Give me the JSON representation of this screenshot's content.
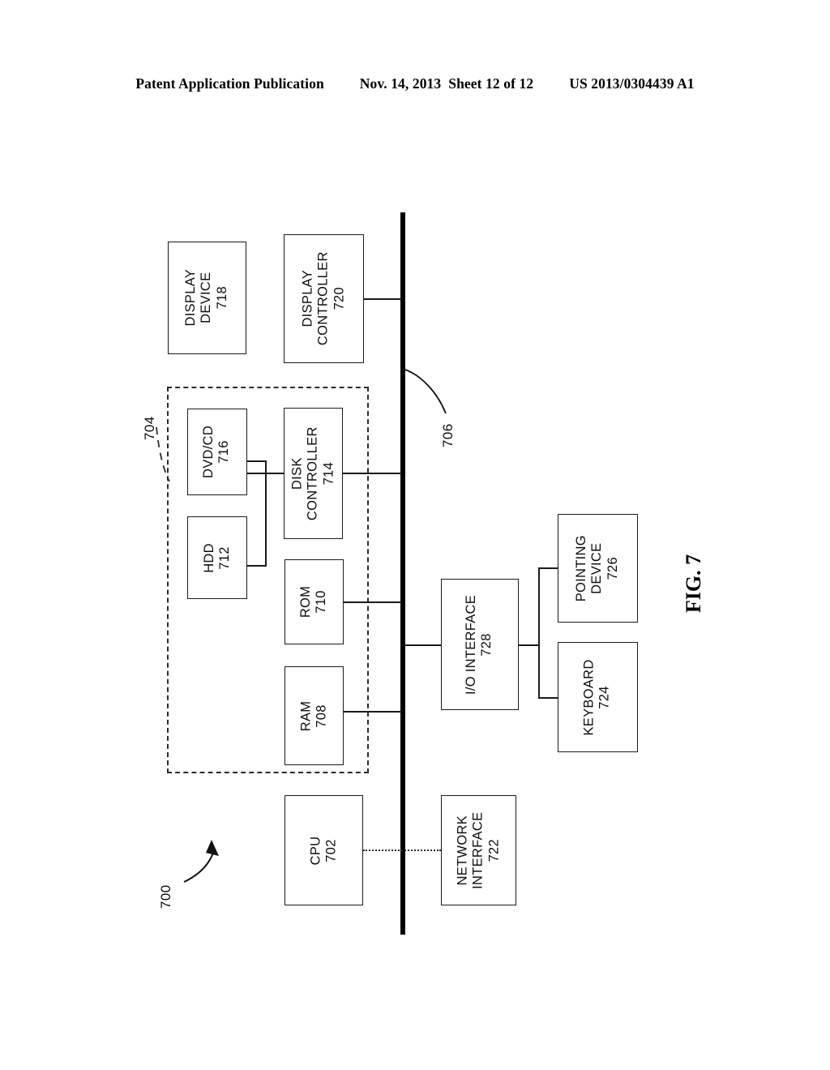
{
  "header": {
    "publication": "Patent Application Publication",
    "date": "Nov. 14, 2013",
    "sheet": "Sheet 12 of 12",
    "patent_number": "US 2013/0304439 A1"
  },
  "figure": {
    "caption": "FIG. 7",
    "system_ref": "700",
    "memory_group_ref": "704",
    "bus_ref": "706"
  },
  "blocks": {
    "display_device": {
      "line1": "DISPLAY",
      "line2": "DEVICE",
      "ref": "718"
    },
    "display_controller": {
      "line1": "DISPLAY",
      "line2": "CONTROLLER",
      "ref": "720"
    },
    "dvd_cd": {
      "line1": "DVD/CD",
      "ref": "716"
    },
    "hdd": {
      "line1": "HDD",
      "ref": "712"
    },
    "disk_controller": {
      "line1": "DISK",
      "line2": "CONTROLLER",
      "ref": "714"
    },
    "rom": {
      "line1": "ROM",
      "ref": "710"
    },
    "ram": {
      "line1": "RAM",
      "ref": "708"
    },
    "io_interface": {
      "line1": "I/O INTERFACE",
      "ref": "728"
    },
    "pointing_device": {
      "line1": "POINTING",
      "line2": "DEVICE",
      "ref": "726"
    },
    "keyboard": {
      "line1": "KEYBOARD",
      "ref": "724"
    },
    "cpu": {
      "line1": "CPU",
      "ref": "702"
    },
    "network_interface": {
      "line1": "NETWORK",
      "line2": "INTERFACE",
      "ref": "722"
    }
  }
}
